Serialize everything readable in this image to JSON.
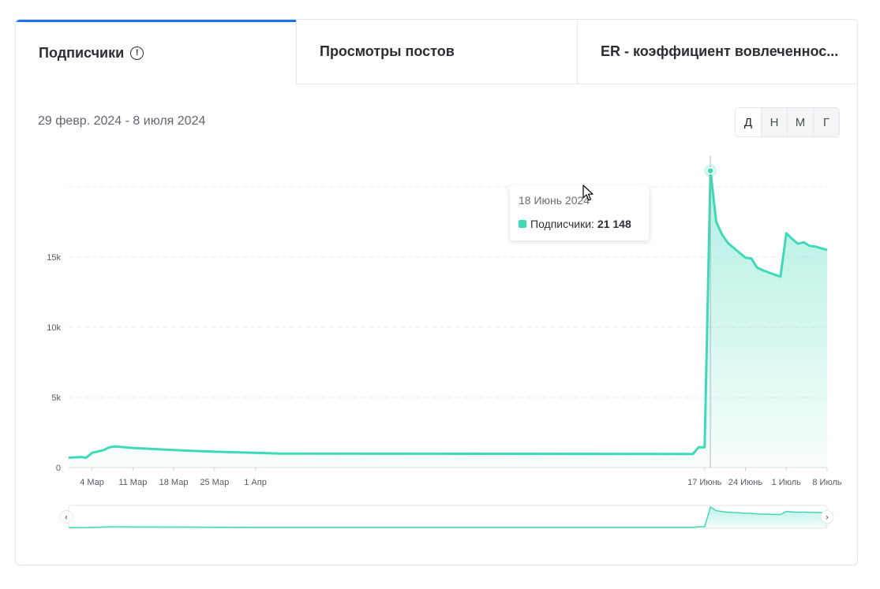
{
  "tabs": [
    {
      "label": "Подписчики",
      "active": true,
      "has_info_icon": true
    },
    {
      "label": "Просмотры постов",
      "active": false
    },
    {
      "label": "ER - коэффициент вовлеченнос...",
      "active": false
    }
  ],
  "date_range": "29 февр. 2024 - 8 июля 2024",
  "period_buttons": [
    {
      "label": "Д",
      "active": true
    },
    {
      "label": "Н",
      "active": false
    },
    {
      "label": "М",
      "active": false
    },
    {
      "label": "Г",
      "active": false
    }
  ],
  "tooltip": {
    "date": "18 Июнь 2024",
    "series_label": "Подписчики:",
    "value": "21 148"
  },
  "colors": {
    "accent": "#1a73e8",
    "series": "#40d9b8",
    "fill": "#b5f0e2"
  },
  "chart_data": {
    "type": "area",
    "title": "",
    "xlabel": "",
    "ylabel": "",
    "x_range": [
      "2024-02-29",
      "2024-07-08"
    ],
    "ylim": [
      0,
      20000
    ],
    "y_ticks": [
      0,
      5000,
      10000,
      15000
    ],
    "y_tick_labels": [
      "0",
      "5k",
      "10k",
      "15k"
    ],
    "x_ticks": [
      "2024-03-04",
      "2024-03-11",
      "2024-03-18",
      "2024-03-25",
      "2024-04-01",
      "2024-06-17",
      "2024-06-24",
      "2024-07-01",
      "2024-07-08"
    ],
    "x_tick_labels": [
      "4 Мар",
      "11 Мар",
      "18 Мар",
      "25 Мар",
      "1 Апр",
      "17 Июнь",
      "24 Июнь",
      "1 Июль",
      "8 Июль"
    ],
    "grid": true,
    "series": [
      {
        "name": "Подписчики",
        "points": [
          [
            "2024-02-29",
            700
          ],
          [
            "2024-03-02",
            750
          ],
          [
            "2024-03-03",
            700
          ],
          [
            "2024-03-04",
            1050
          ],
          [
            "2024-03-06",
            1250
          ],
          [
            "2024-03-07",
            1450
          ],
          [
            "2024-03-08",
            1500
          ],
          [
            "2024-03-11",
            1400
          ],
          [
            "2024-03-18",
            1250
          ],
          [
            "2024-03-25",
            1130
          ],
          [
            "2024-04-01",
            1050
          ],
          [
            "2024-04-05",
            1000
          ],
          [
            "2024-06-15",
            970
          ],
          [
            "2024-06-16",
            1450
          ],
          [
            "2024-06-17",
            1450
          ],
          [
            "2024-06-18",
            21148
          ],
          [
            "2024-06-19",
            17500
          ],
          [
            "2024-06-20",
            16600
          ],
          [
            "2024-06-21",
            16000
          ],
          [
            "2024-06-24",
            14950
          ],
          [
            "2024-06-25",
            14900
          ],
          [
            "2024-06-26",
            14250
          ],
          [
            "2024-06-27",
            14050
          ],
          [
            "2024-06-29",
            13750
          ],
          [
            "2024-06-30",
            13600
          ],
          [
            "2024-07-01",
            16700
          ],
          [
            "2024-07-02",
            16300
          ],
          [
            "2024-07-03",
            15950
          ],
          [
            "2024-07-04",
            16050
          ],
          [
            "2024-07-05",
            15800
          ],
          [
            "2024-07-06",
            15750
          ],
          [
            "2024-07-08",
            15500
          ]
        ]
      }
    ],
    "hover_point": [
      "2024-06-18",
      21148
    ]
  }
}
